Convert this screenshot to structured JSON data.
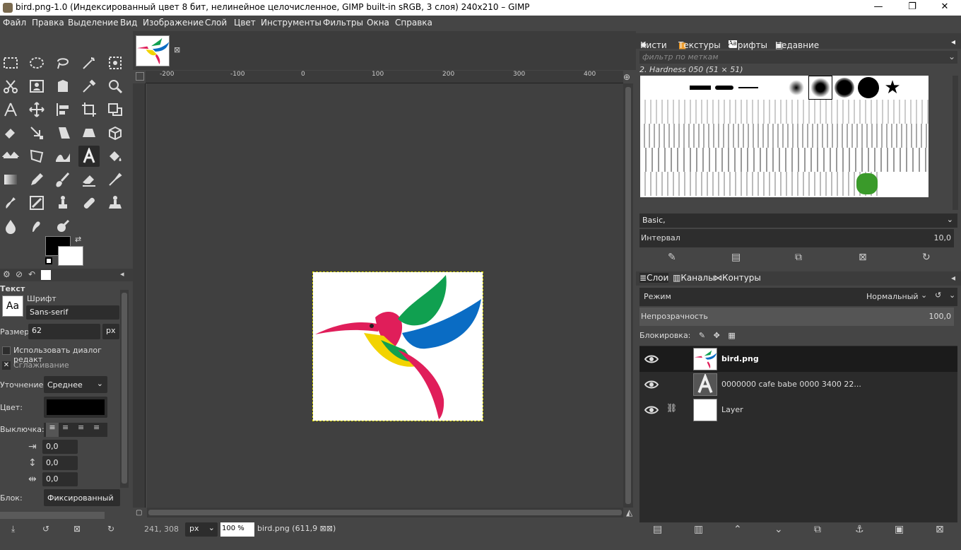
{
  "window": {
    "title": "bird.png-1.0 (Индексированный цвет 8 бит, нелинейное целочисленное, GIMP built-in sRGB, 3 слоя) 240x210 – GIMP",
    "minimize": "—",
    "maximize": "❐",
    "close": "✕"
  },
  "menu": [
    "Файл",
    "Правка",
    "Выделение",
    "Вид",
    "Изображение",
    "Слой",
    "Цвет",
    "Инструменты",
    "Фильтры",
    "Окна",
    "Справка"
  ],
  "tool_options": {
    "title": "Текст",
    "font_label": "Шрифт",
    "font_value": "Sans-serif",
    "size_label": "Размер:",
    "size_value": "62",
    "size_unit": "px",
    "use_dialog": "Использовать диалог редакт",
    "antialias": "Сглаживание",
    "hinting_label": "Уточнение:",
    "hinting_value": "Среднее",
    "color_label": "Цвет:",
    "justify_label": "Выключка:",
    "indent": "0,0",
    "line_spacing": "0,0",
    "letter_spacing": "0,0",
    "box_label": "Блок:",
    "box_value": "Фиксированный"
  },
  "ruler": {
    "h": [
      "-200",
      "-100",
      "0",
      "100",
      "200",
      "300",
      "400"
    ]
  },
  "status": {
    "coords": "241, 308",
    "unit": "px",
    "zoom": "100 %",
    "info": "bird.png (611,9 ⊠⊠)"
  },
  "brushes": {
    "tabs": [
      "Кисти",
      "Текстуры",
      "Шрифты",
      "Недавние изображения"
    ],
    "filter_placeholder": "фильтр по меткам",
    "current": "2. Hardness 050 (51 × 51)",
    "tag": "Basic,",
    "interval_label": "Интервал",
    "interval_value": "10,0"
  },
  "layers": {
    "tabs": [
      "Слои",
      "Каналы",
      "Контуры"
    ],
    "mode_label": "Режим",
    "mode_value": "Нормальный",
    "opacity_label": "Непрозрачность",
    "opacity_value": "100,0",
    "lock_label": "Блокировка:",
    "items": [
      {
        "name": "bird.png"
      },
      {
        "name": "0000000 cafe babe 0000 3400 22..."
      },
      {
        "name": "Layer"
      }
    ]
  }
}
